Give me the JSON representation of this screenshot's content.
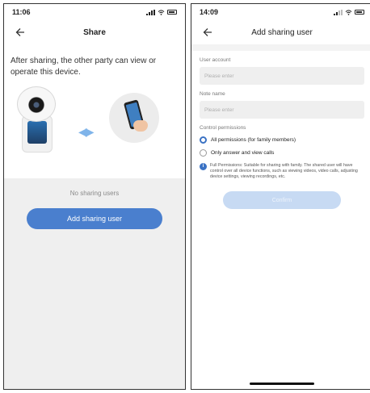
{
  "left": {
    "status": {
      "time": "11:06"
    },
    "nav": {
      "back_icon": "back-arrow-icon",
      "title": "Share"
    },
    "description": "After sharing, the other party can view or operate this device.",
    "empty_text": "No sharing users",
    "add_button_label": "Add sharing user",
    "accent_color": "#4a7fce"
  },
  "right": {
    "status": {
      "time": "14:09"
    },
    "nav": {
      "back_icon": "back-arrow-icon",
      "title": "Add sharing user"
    },
    "account": {
      "label": "User account",
      "placeholder": "Please enter"
    },
    "note": {
      "label": "Note name",
      "placeholder": "Please enter"
    },
    "permissions": {
      "label": "Control permissions",
      "options": [
        {
          "label": "All permissions (for family members)",
          "selected": true
        },
        {
          "label": "Only answer and view calls",
          "selected": false
        }
      ]
    },
    "info_text": "Full Permissions: Suitable for sharing with family. The shared user will have control over all device functions, such as viewing videos, video calls, adjusting device settings, viewing recordings, etc.",
    "confirm_label": "Confirm",
    "accent_color": "#3b72c4"
  }
}
